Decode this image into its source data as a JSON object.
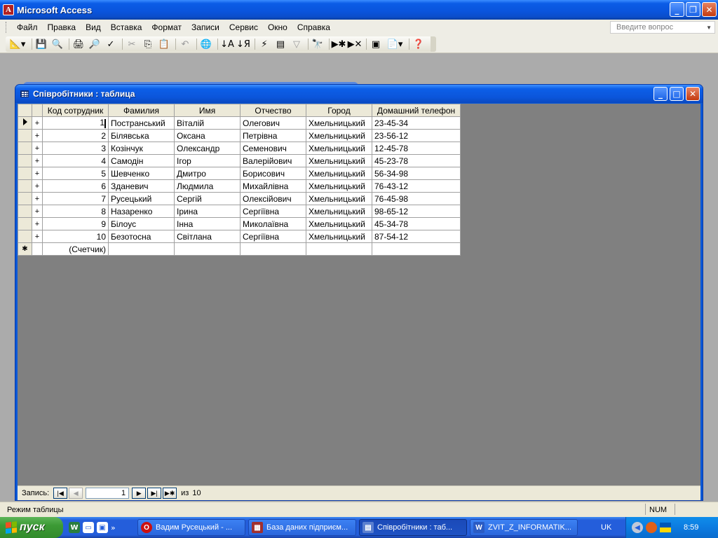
{
  "app": {
    "title": "Microsoft Access"
  },
  "menu": {
    "items": [
      "Файл",
      "Правка",
      "Вид",
      "Вставка",
      "Формат",
      "Записи",
      "Сервис",
      "Окно",
      "Справка"
    ],
    "help_placeholder": "Введите вопрос"
  },
  "toolbar": {
    "icons": [
      "design-view",
      "save",
      "print-preview-search",
      "print",
      "print-preview",
      "spelling",
      "cut",
      "copy",
      "paste",
      "undo",
      "insert-hyperlink",
      "sort-ascending",
      "sort-descending",
      "filter-by-selection",
      "filter-by-form",
      "apply-filter",
      "find",
      "new-record",
      "delete-record",
      "database-window",
      "new-object",
      "help"
    ]
  },
  "table_window": {
    "title": "Співробітники : таблица",
    "columns": [
      "Код сотрудник",
      "Фамилия",
      "Имя",
      "Отчество",
      "Город",
      "Домашний телефон"
    ],
    "rows": [
      {
        "id": "1",
        "surname": "Постранський",
        "name": "Віталій",
        "patronymic": "Олегович",
        "city": "Хмельницький",
        "phone": "23-45-34"
      },
      {
        "id": "2",
        "surname": "Білявська",
        "name": "Оксана",
        "patronymic": "Петрівна",
        "city": "Хмельницький",
        "phone": "23-56-12"
      },
      {
        "id": "3",
        "surname": "Козінчук",
        "name": "Олександр",
        "patronymic": "Семенович",
        "city": "Хмельницький",
        "phone": "12-45-78"
      },
      {
        "id": "4",
        "surname": "Самодін",
        "name": "Ігор",
        "patronymic": "Валерійович",
        "city": "Хмельницький",
        "phone": "45-23-78"
      },
      {
        "id": "5",
        "surname": "Шевченко",
        "name": "Дмитро",
        "patronymic": "Борисович",
        "city": "Хмельницький",
        "phone": "56-34-98"
      },
      {
        "id": "6",
        "surname": "Зданевич",
        "name": "Людмила",
        "patronymic": "Михайлівна",
        "city": "Хмельницький",
        "phone": "76-43-12"
      },
      {
        "id": "7",
        "surname": "Русецький",
        "name": "Сергій",
        "patronymic": "Олексійович",
        "city": "Хмельницький",
        "phone": "76-45-98"
      },
      {
        "id": "8",
        "surname": "Назаренко",
        "name": "Ірина",
        "patronymic": "Сергіївна",
        "city": "Хмельницький",
        "phone": "98-65-12"
      },
      {
        "id": "9",
        "surname": "Білоус",
        "name": "Інна",
        "patronymic": "Миколаївна",
        "city": "Хмельницький",
        "phone": "45-34-78"
      },
      {
        "id": "10",
        "surname": "Безотосна",
        "name": "Світлана",
        "patronymic": "Сергіївна",
        "city": "Хмельницький",
        "phone": "87-54-12"
      }
    ],
    "new_row_placeholder": "(Счетчик)",
    "expand_symbol": "+",
    "new_row_symbol": "✱",
    "nav": {
      "label": "Запись:",
      "current": "1",
      "of_label": "из",
      "total": "10"
    }
  },
  "statusbar": {
    "mode": "Режим таблицы",
    "num": "NUM"
  },
  "taskbar": {
    "start_label": "пуск",
    "quicklaunch_more": "»",
    "tasks": [
      {
        "label": "Вадим Русецький - ...",
        "icon": "opera-icon",
        "color": "#CC1111"
      },
      {
        "label": "База даних підприєм...",
        "icon": "access-icon",
        "color": "#A03030"
      },
      {
        "label": "Співробітники : таб...",
        "icon": "table-icon",
        "color": "#5A7FD0"
      },
      {
        "label": "ZVIT_Z_INFORMATIK...",
        "icon": "word-icon",
        "color": "#2A5BC4"
      }
    ],
    "lang": "UK",
    "clock": "8:59"
  }
}
